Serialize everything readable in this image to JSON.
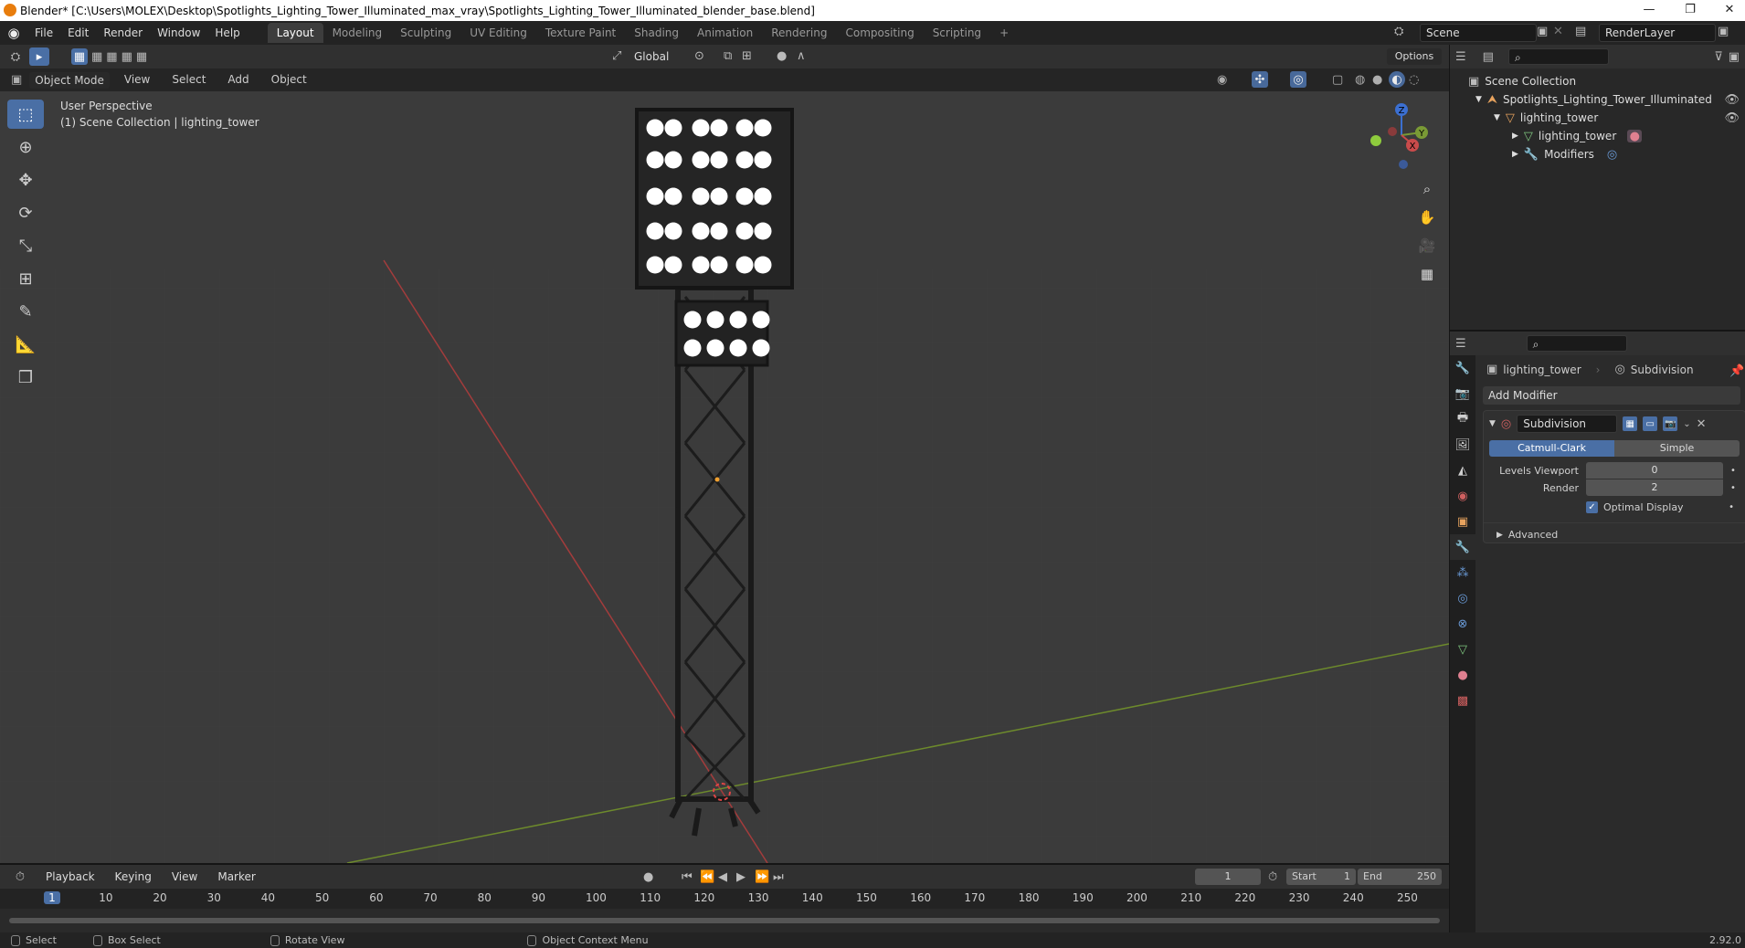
{
  "window": {
    "title": "Blender* [C:\\Users\\MOLEX\\Desktop\\Spotlights_Lighting_Tower_Illuminated_max_vray\\Spotlights_Lighting_Tower_Illuminated_blender_base.blend]",
    "minimize": "—",
    "restore": "❐",
    "close": "✕"
  },
  "menu": [
    "File",
    "Edit",
    "Render",
    "Window",
    "Help"
  ],
  "workspaces": [
    "Layout",
    "Modeling",
    "Sculpting",
    "UV Editing",
    "Texture Paint",
    "Shading",
    "Animation",
    "Rendering",
    "Compositing",
    "Scripting"
  ],
  "workspace_add": "+",
  "scene": {
    "label": "Scene",
    "render_layer": "RenderLayer"
  },
  "viewport_header": {
    "mode": "Object Mode",
    "menus": [
      "View",
      "Select",
      "Add",
      "Object"
    ],
    "transform": "Global",
    "options": "Options"
  },
  "viewport": {
    "perspective": "User Perspective",
    "collection_info": "(1) Scene Collection | lighting_tower",
    "gizmo": {
      "x": "X",
      "y": "Y",
      "z": "Z"
    }
  },
  "outliner": {
    "root": "Scene Collection",
    "items": [
      {
        "label": "Spotlights_Lighting_Tower_Illuminated",
        "depth": 1
      },
      {
        "label": "lighting_tower",
        "depth": 2
      },
      {
        "label": "lighting_tower",
        "depth": 3
      },
      {
        "label": "Modifiers",
        "depth": 3
      }
    ]
  },
  "properties": {
    "object_name": "lighting_tower",
    "modifier_context": "Subdivision",
    "add_modifier": "Add Modifier",
    "modifier": {
      "name": "Subdivision",
      "types": [
        "Catmull-Clark",
        "Simple"
      ],
      "active_type": "Catmull-Clark",
      "levels_viewport_label": "Levels Viewport",
      "levels_viewport": "0",
      "render_label": "Render",
      "render": "2",
      "optimal_display_label": "Optimal Display",
      "optimal_display": true,
      "advanced": "Advanced"
    }
  },
  "timeline": {
    "menus": [
      "Playback",
      "Keying",
      "View",
      "Marker"
    ],
    "current_frame": "1",
    "start_label": "Start",
    "start": "1",
    "end_label": "End",
    "end": "250",
    "ticks": [
      "1",
      "10",
      "20",
      "30",
      "40",
      "50",
      "60",
      "70",
      "80",
      "90",
      "100",
      "110",
      "120",
      "130",
      "140",
      "150",
      "160",
      "170",
      "180",
      "190",
      "200",
      "210",
      "220",
      "230",
      "240",
      "250"
    ]
  },
  "statusbar": {
    "select": "Select",
    "box_select": "Box Select",
    "rotate_view": "Rotate View",
    "context_menu": "Object Context Menu",
    "version": "2.92.0"
  },
  "colors": {
    "accent": "#4a6fa5",
    "x_axis": "#c94b4b",
    "y_axis": "#7a9a35",
    "z_axis": "#3b6fd1",
    "lamp": "#ffffff"
  }
}
